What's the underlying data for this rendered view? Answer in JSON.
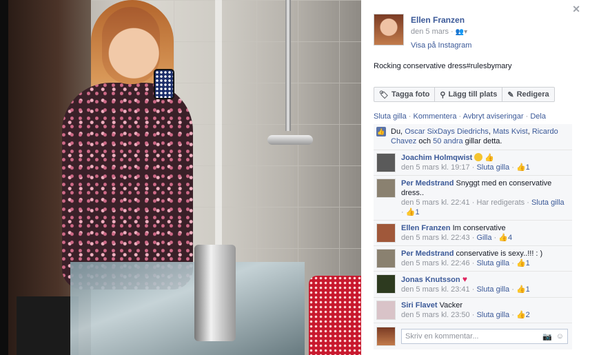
{
  "post": {
    "author": "Ellen Franzen",
    "date": "den 5 mars",
    "instagram_link": "Visa på Instagram",
    "caption": "Rocking conservative dress#rulesbymary"
  },
  "toolbar": {
    "tag_photo": "Tagga foto",
    "add_place": "Lägg till plats",
    "edit": "Redigera"
  },
  "actions": {
    "unlike": "Sluta gilla",
    "comment": "Kommentera",
    "unfollow": "Avbryt aviseringar",
    "share": "Dela"
  },
  "likes": {
    "prefix": "Du,",
    "person1": "Oscar SixDays Diedrichs",
    "person2": "Mats Kvist",
    "person3": "Ricardo Chavez",
    "and": "och",
    "others": "50 andra",
    "suffix": "gillar detta."
  },
  "comments": [
    {
      "name": "Joachim Holmqwist",
      "text": "",
      "time": "den 5 mars kl. 19:17",
      "edited": "",
      "like_action": "Sluta gilla",
      "likes": "1",
      "avatar_color": "#5a5a5a"
    },
    {
      "name": "Per Medstrand",
      "text": "Snyggt med en conservative dress..",
      "time": "den 5 mars kl. 22:41",
      "edited": "Har redigerats",
      "like_action": "Sluta gilla",
      "likes": "1",
      "avatar_color": "#8a8170"
    },
    {
      "name": "Ellen Franzen",
      "text": "Im conservative",
      "time": "den 5 mars kl. 22:43",
      "edited": "",
      "like_action": "Gilla",
      "likes": "4",
      "avatar_color": "#a0583a"
    },
    {
      "name": "Per Medstrand",
      "text": "conservative is sexy..!!! : )",
      "time": "den 5 mars kl. 22:46",
      "edited": "",
      "like_action": "Sluta gilla",
      "likes": "1",
      "avatar_color": "#8a8170"
    },
    {
      "name": "Jonas Knutsson",
      "text": "",
      "time": "den 5 mars kl. 23:41",
      "edited": "",
      "like_action": "Sluta gilla",
      "likes": "1",
      "avatar_color": "#2d3a1f"
    },
    {
      "name": "Siri Flavet",
      "text": "Vacker",
      "time": "den 5 mars kl. 23:50",
      "edited": "",
      "like_action": "Sluta gilla",
      "likes": "2",
      "avatar_color": "#d9c3c8"
    }
  ],
  "composer": {
    "placeholder": "Skriv en kommentar..."
  }
}
